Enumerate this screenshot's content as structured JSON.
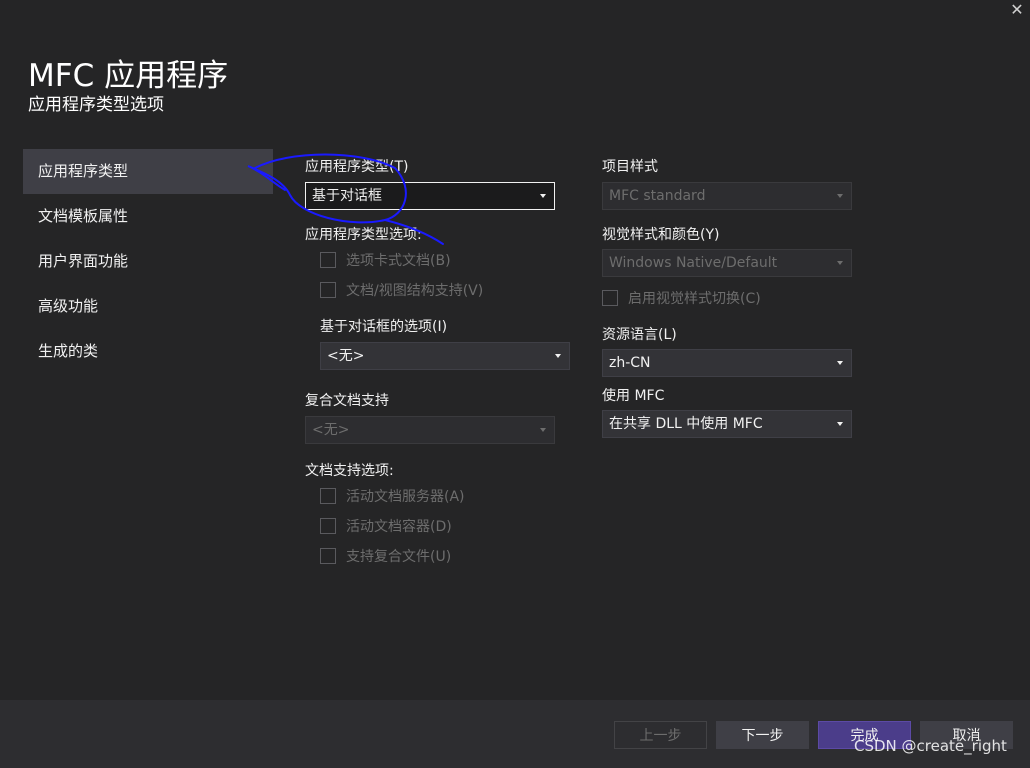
{
  "window": {
    "title": "MFC 应用程序",
    "subtitle": "应用程序类型选项",
    "close_glyph": "✕"
  },
  "nav": {
    "items": [
      "应用程序类型",
      "文档模板属性",
      "用户界面功能",
      "高级功能",
      "生成的类"
    ],
    "active_index": 0
  },
  "app_type": {
    "label": "应用程序类型(T)",
    "value": "基于对话框"
  },
  "app_type_options": {
    "label": "应用程序类型选项:",
    "tabbed_docs": "选项卡式文档(B)",
    "doc_view": "文档/视图结构支持(V)"
  },
  "dialog_options": {
    "label": "基于对话框的选项(I)",
    "value": "<无>"
  },
  "compound_doc": {
    "label": "复合文档支持",
    "value": "<无>"
  },
  "doc_support_options": {
    "label": "文档支持选项:",
    "active_doc_server": "活动文档服务器(A)",
    "active_doc_container": "活动文档容器(D)",
    "compound_files": "支持复合文件(U)"
  },
  "project_style": {
    "label": "项目样式",
    "value": "MFC standard"
  },
  "visual_style": {
    "label": "视觉样式和颜色(Y)",
    "value": "Windows Native/Default",
    "toggle_label": "启用视觉样式切换(C)"
  },
  "resource_language": {
    "label": "资源语言(L)",
    "value": "zh-CN"
  },
  "use_mfc": {
    "label": "使用 MFC",
    "value": "在共享 DLL 中使用 MFC"
  },
  "footer": {
    "prev": "上一步",
    "next": "下一步",
    "finish": "完成",
    "cancel": "取消"
  },
  "watermark": "CSDN @create_right",
  "colors": {
    "background": "#252526",
    "active_nav": "#3f3f46",
    "primary_button": "#4b3d8a",
    "annotation_ink": "#1a1aff"
  }
}
